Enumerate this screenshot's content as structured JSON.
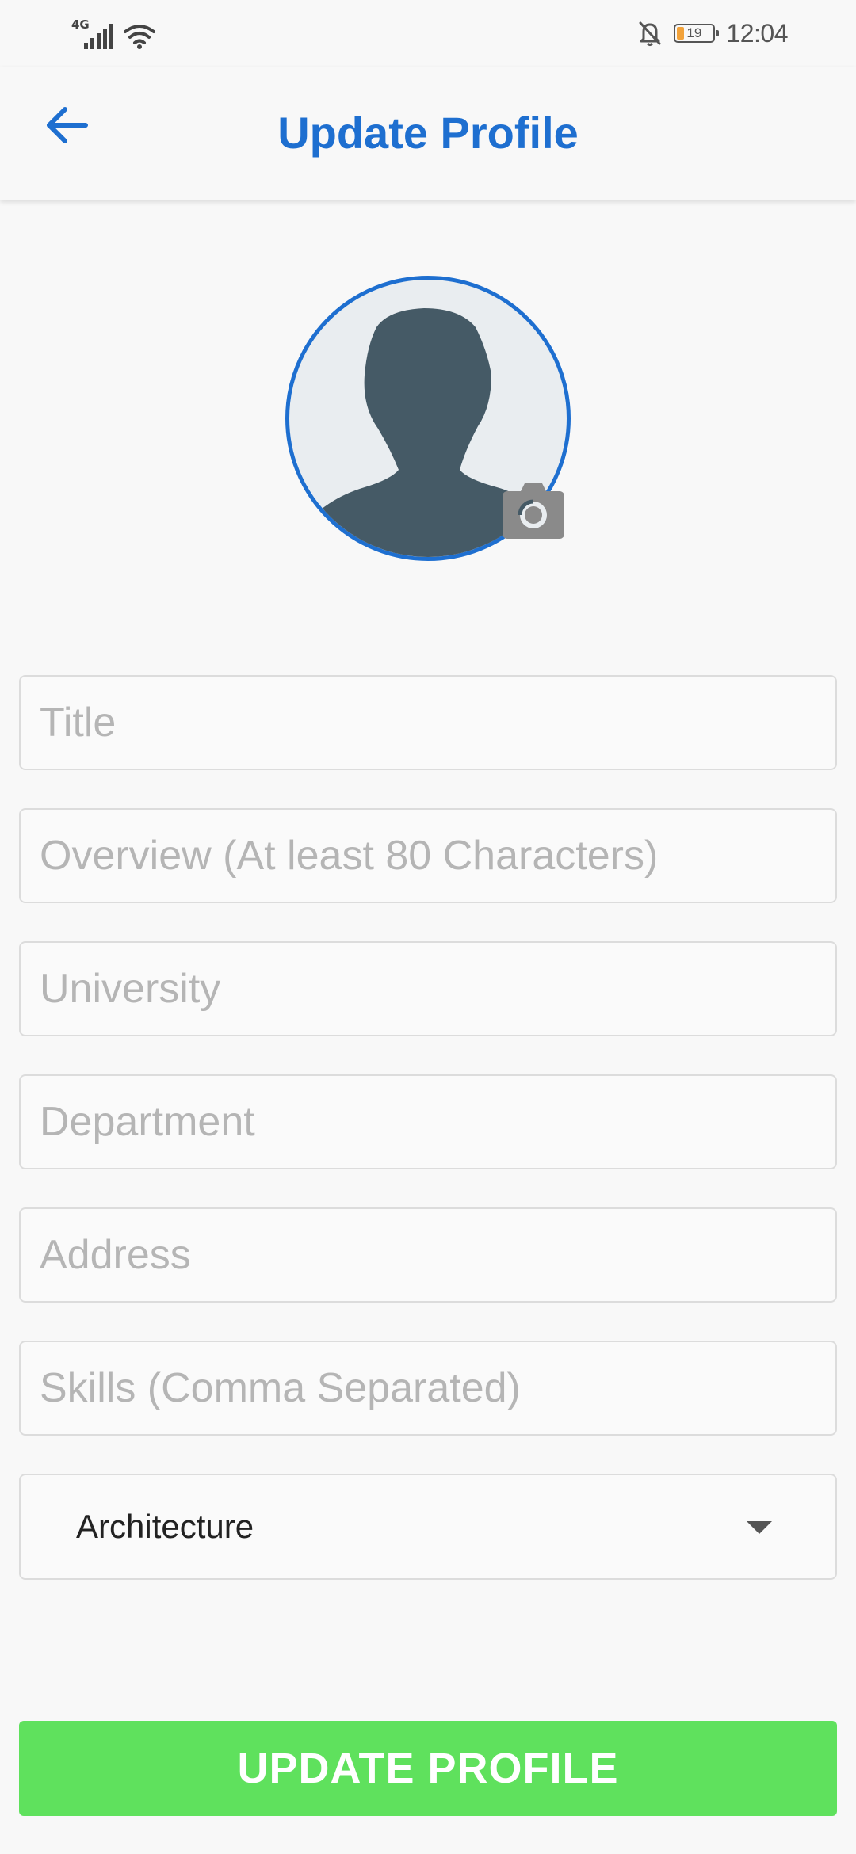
{
  "status_bar": {
    "network_type": "4G",
    "battery_level": "19",
    "time": "12:04",
    "icons": [
      "signal-icon",
      "wifi-icon",
      "bell-off-icon",
      "battery-icon"
    ]
  },
  "app_bar": {
    "title": "Update Profile",
    "back_icon": "arrow-left-icon"
  },
  "avatar": {
    "icon": "person-silhouette-icon",
    "camera_icon": "camera-icon"
  },
  "form": {
    "title_placeholder": "Title",
    "overview_placeholder": "Overview (At least 80 Characters)",
    "university_placeholder": "University",
    "department_placeholder": "Department",
    "address_placeholder": "Address",
    "skills_placeholder": "Skills (Comma Separated)",
    "category_selected": "Architecture",
    "submit_label": "UPDATE PROFILE"
  },
  "colors": {
    "accent": "#1e6fd0",
    "submit": "#5fe15d",
    "battery": "#f2a23a"
  }
}
